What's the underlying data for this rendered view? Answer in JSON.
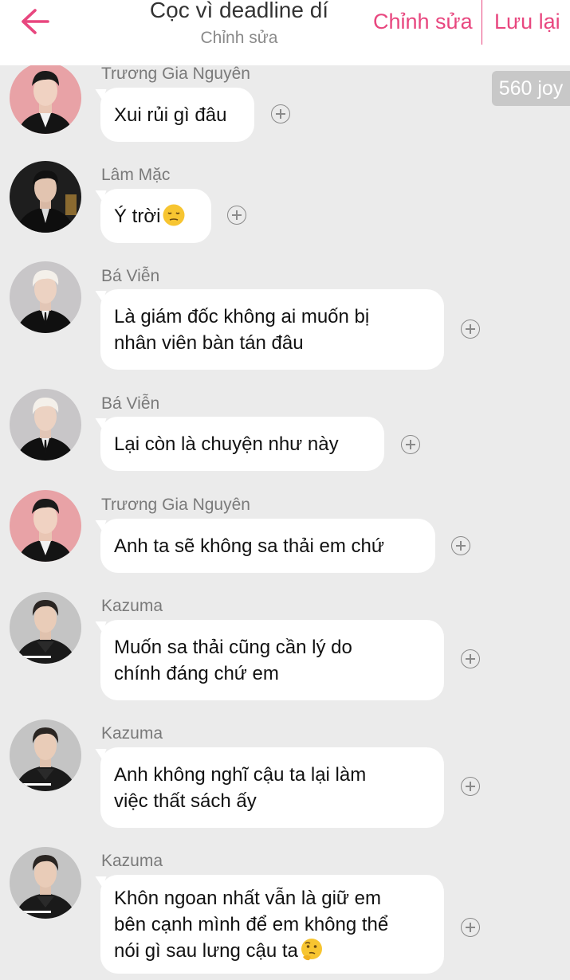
{
  "header": {
    "title": "Cọc vì deadline dí",
    "subtitle": "Chỉnh sửa",
    "edit_label": "Chỉnh sửa",
    "save_label": "Lưu lại",
    "accent_color": "#e8477f"
  },
  "badge": {
    "text": "560 joy"
  },
  "messages": [
    {
      "sender": "Trương Gia Nguyên",
      "lines": [
        "Xui rủi gì đâu"
      ],
      "avatar": "avatar-red-bg-man",
      "emoji": ""
    },
    {
      "sender": "Lâm Mặc",
      "lines": [
        "Ý trời"
      ],
      "avatar": "avatar-dark-suit-man",
      "emoji": "sad-face-emoji"
    },
    {
      "sender": "Bá Viễn",
      "lines": [
        "Là giám đốc không ai muốn bị",
        "nhân viên bàn tán đâu"
      ],
      "avatar": "avatar-white-hair-man",
      "emoji": ""
    },
    {
      "sender": "Bá Viễn",
      "lines": [
        "Lại còn là chuyện như này"
      ],
      "avatar": "avatar-white-hair-man",
      "emoji": ""
    },
    {
      "sender": "Trương Gia Nguyên",
      "lines": [
        "Anh ta sẽ không sa thải em chứ"
      ],
      "avatar": "avatar-red-bg-man",
      "emoji": ""
    },
    {
      "sender": "Kazuma",
      "lines": [
        "Muốn sa thải cũng cần lý do",
        "chính đáng chứ em"
      ],
      "avatar": "avatar-kazuma",
      "emoji": ""
    },
    {
      "sender": "Kazuma",
      "lines": [
        "Anh không nghĩ cậu ta lại làm",
        "việc thất sách ấy"
      ],
      "avatar": "avatar-kazuma",
      "emoji": ""
    },
    {
      "sender": "Kazuma",
      "lines": [
        "Khôn ngoan nhất vẫn là giữ em",
        "bên cạnh mình để em không thể",
        "nói gì sau lưng cậu ta"
      ],
      "avatar": "avatar-kazuma",
      "emoji": "thinking-face-emoji"
    }
  ]
}
